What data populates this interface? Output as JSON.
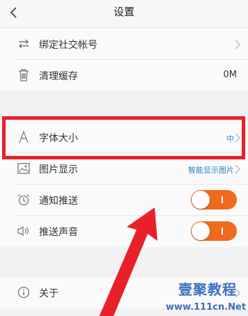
{
  "header": {
    "title": "设置"
  },
  "rows": {
    "bind_social": {
      "label": "绑定社交帐号"
    },
    "clear_cache": {
      "label": "清理缓存",
      "value": "0M"
    },
    "font_size": {
      "label": "字体大小",
      "value": "中"
    },
    "image_display": {
      "label": "图片显示",
      "value": "智能显示图片"
    },
    "notifications": {
      "label": "通知推送",
      "toggle_on": true
    },
    "push_sound": {
      "label": "推送声音",
      "toggle_on": true
    },
    "about": {
      "label": "关于"
    }
  },
  "watermark": {
    "logo": "壹聚教程",
    "url": "www.111cn.Net"
  },
  "colors": {
    "toggle": "#f06a1e",
    "highlight": "#e8202a",
    "link_blue": "#2d83c8"
  },
  "icons": [
    "back-arrow-icon",
    "swap-arrows-icon",
    "trash-icon",
    "font-a-icon",
    "image-icon",
    "alarm-clock-icon",
    "speaker-icon",
    "info-circle-icon",
    "chevron-right-icon"
  ]
}
